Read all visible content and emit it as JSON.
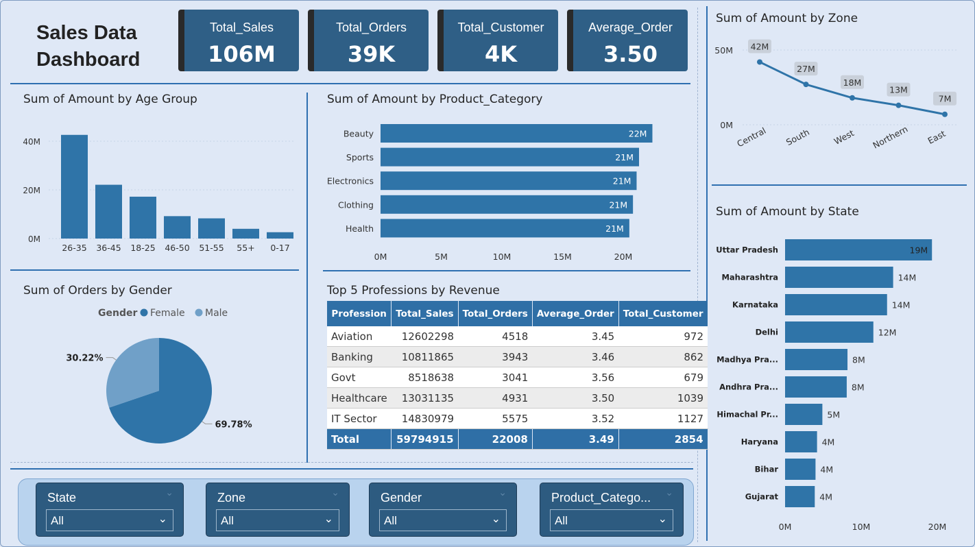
{
  "header": {
    "title_line1": "Sales Data",
    "title_line2": "Dashboard"
  },
  "kpis": [
    {
      "label": "Total_Sales",
      "value": "106M"
    },
    {
      "label": "Total_Orders",
      "value": "39K"
    },
    {
      "label": "Total_Customer",
      "value": "4K"
    },
    {
      "label": "Average_Order",
      "value": "3.50"
    }
  ],
  "colors": {
    "accent": "#2f74a8",
    "light": "#70a0c8",
    "kpi_bg": "#2f5f86",
    "divider": "#2e6fb0",
    "background": "#dfe8f6"
  },
  "chart_data": [
    {
      "id": "age",
      "type": "bar",
      "title": "Sum of Amount by Age Group",
      "categories": [
        "26-35",
        "36-45",
        "18-25",
        "46-50",
        "51-55",
        "55+",
        "0-17"
      ],
      "values": [
        42.6,
        22.1,
        17.2,
        9.2,
        8.3,
        4.0,
        2.6
      ],
      "y_ticks": [
        "0M",
        "20M",
        "40M"
      ],
      "ylim": [
        0,
        40
      ],
      "grid": true
    },
    {
      "id": "category",
      "type": "bar",
      "orientation": "horizontal",
      "title": "Sum of Amount by Product_Category",
      "categories": [
        "Beauty",
        "Sports",
        "Electronics",
        "Clothing",
        "Health"
      ],
      "values": [
        22.4,
        21.3,
        21.1,
        20.8,
        20.5
      ],
      "data_labels": [
        "22M",
        "21M",
        "21M",
        "21M",
        "21M"
      ],
      "x_ticks": [
        "0M",
        "5M",
        "10M",
        "15M",
        "20M"
      ],
      "xlim": [
        0,
        20
      ]
    },
    {
      "id": "gender",
      "type": "pie",
      "title": "Sum of Orders by Gender",
      "legend_title": "Gender",
      "legend_position": "top",
      "slices": [
        {
          "name": "Female",
          "value": 69.78,
          "label": "69.78%",
          "color": "#2f74a8"
        },
        {
          "name": "Male",
          "value": 30.22,
          "label": "30.22%",
          "color": "#70a0c8"
        }
      ]
    },
    {
      "id": "zone",
      "type": "line",
      "title": "Sum of Amount by Zone",
      "categories": [
        "Central",
        "South",
        "West",
        "Northern",
        "East"
      ],
      "values": [
        42,
        27,
        18,
        13,
        7
      ],
      "data_labels": [
        "42M",
        "27M",
        "18M",
        "13M",
        "7M"
      ],
      "y_ticks": [
        "0M",
        "50M"
      ],
      "ylim": [
        0,
        50
      ],
      "grid": true
    },
    {
      "id": "state",
      "type": "bar",
      "orientation": "horizontal",
      "title": "Sum of Amount by State",
      "categories": [
        "Uttar Pradesh",
        "Maharashtra",
        "Karnataka",
        "Delhi",
        "Madhya Pra...",
        "Andhra Pra...",
        "Himachal Pr...",
        "Haryana",
        "Bihar",
        "Gujarat"
      ],
      "values": [
        19.3,
        14.2,
        13.4,
        11.6,
        8.2,
        8.1,
        4.9,
        4.2,
        4.0,
        3.9
      ],
      "data_labels": [
        "19M",
        "14M",
        "14M",
        "12M",
        "8M",
        "8M",
        "5M",
        "4M",
        "4M",
        "4M"
      ],
      "x_ticks": [
        "0M",
        "10M",
        "20M"
      ],
      "xlim": [
        0,
        20
      ]
    },
    {
      "id": "professions",
      "type": "table",
      "title": "Top 5 Professions by Revenue",
      "columns": [
        "Profession",
        "Total_Sales",
        "Total_Orders",
        "Average_Order",
        "Total_Customer"
      ],
      "rows": [
        [
          "Aviation",
          "12602298",
          "4518",
          "3.45",
          "972"
        ],
        [
          "Banking",
          "10811865",
          "3943",
          "3.46",
          "862"
        ],
        [
          "Govt",
          "8518638",
          "3041",
          "3.56",
          "679"
        ],
        [
          "Healthcare",
          "13031135",
          "4931",
          "3.50",
          "1039"
        ],
        [
          "IT Sector",
          "14830979",
          "5575",
          "3.52",
          "1127"
        ]
      ],
      "total": [
        "Total",
        "59794915",
        "22008",
        "3.49",
        "2854"
      ]
    }
  ],
  "slicers": [
    {
      "title": "State",
      "value": "All"
    },
    {
      "title": "Zone",
      "value": "All"
    },
    {
      "title": "Gender",
      "value": "All"
    },
    {
      "title": "Product_Catego...",
      "value": "All"
    }
  ]
}
